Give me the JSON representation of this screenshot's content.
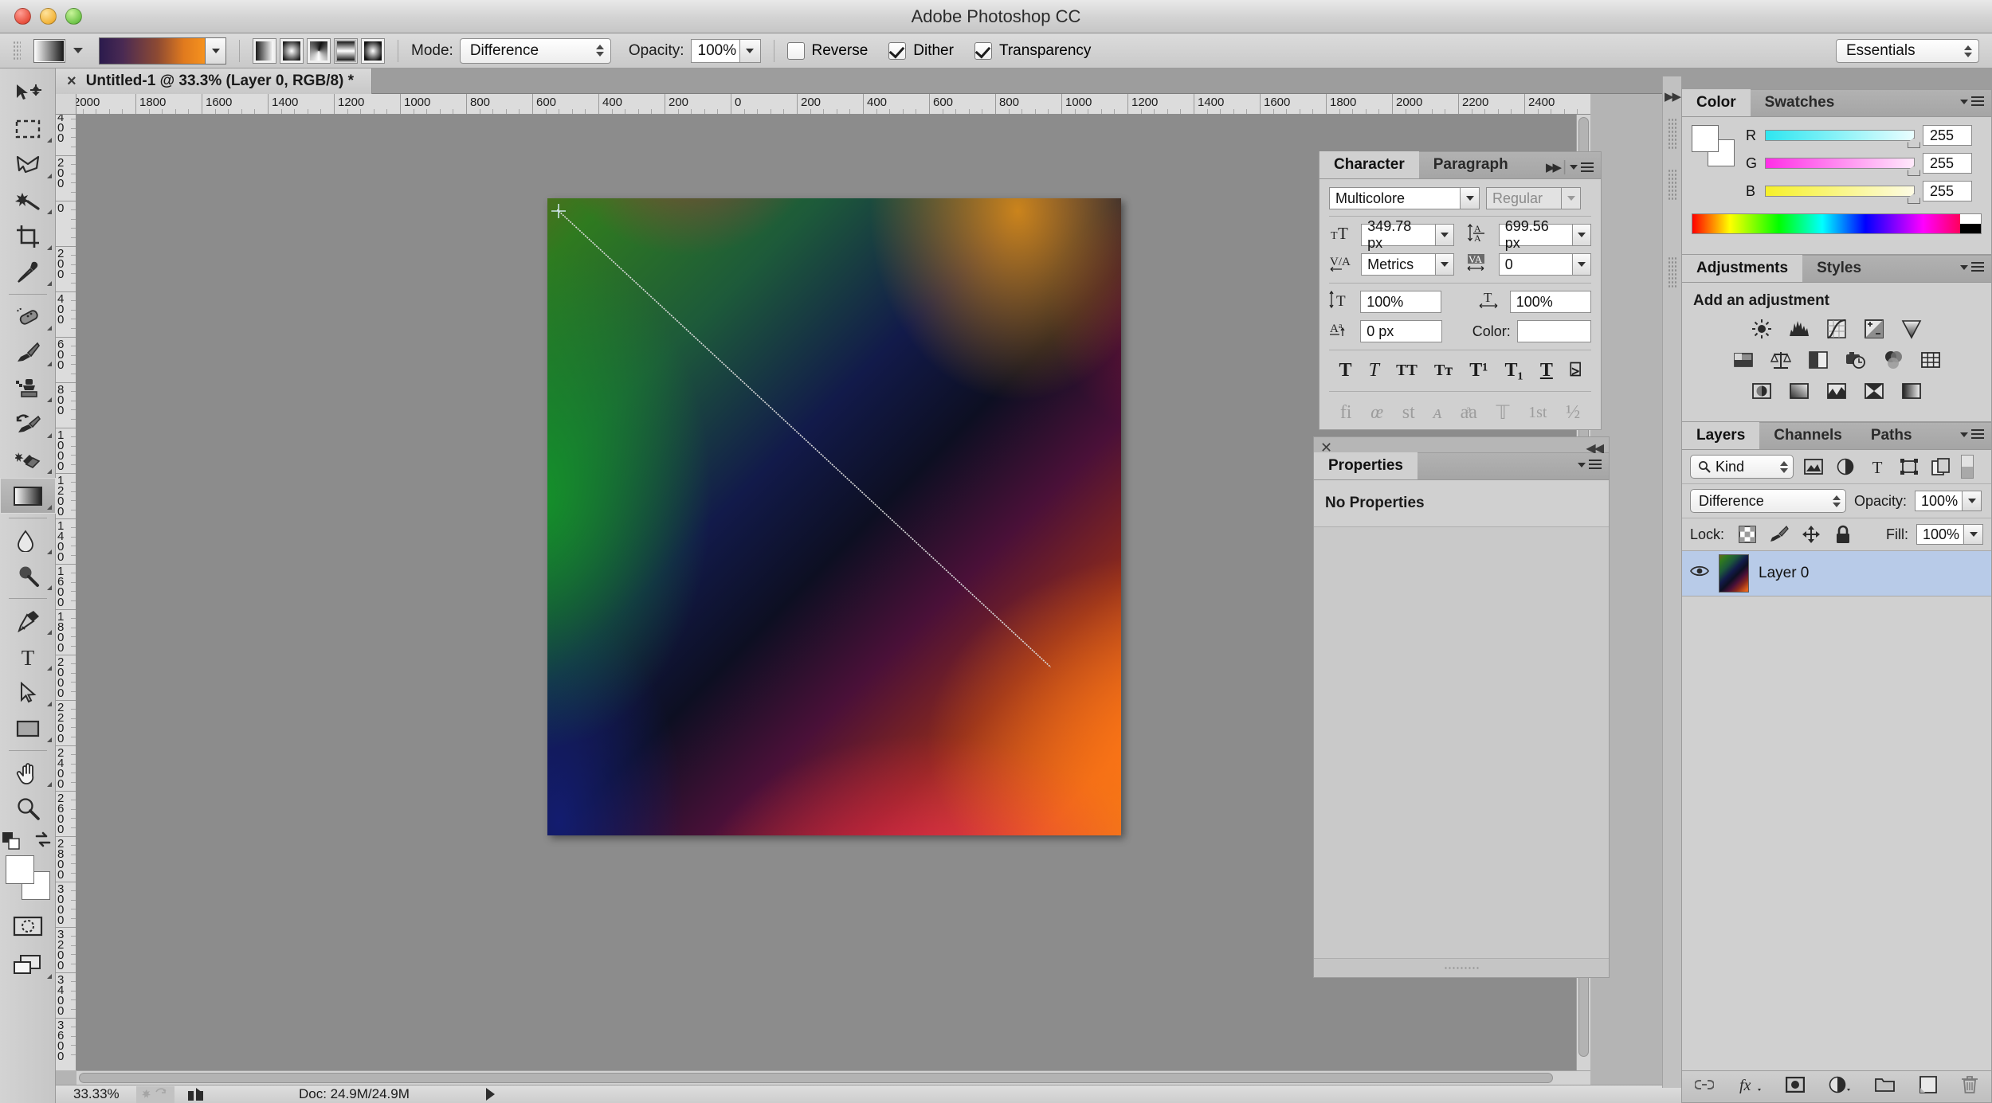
{
  "window": {
    "title": "Adobe Photoshop CC"
  },
  "options_bar": {
    "mode_label": "Mode:",
    "mode_value": "Difference",
    "opacity_label": "Opacity:",
    "opacity_value": "100%",
    "reverse_label": "Reverse",
    "reverse_checked": false,
    "dither_label": "Dither",
    "dither_checked": true,
    "transparency_label": "Transparency",
    "transparency_checked": true,
    "gradient_types": [
      "linear-gradient-icon",
      "radial-gradient-icon",
      "angle-gradient-icon",
      "reflected-gradient-icon",
      "diamond-gradient-icon"
    ],
    "selected_gradient_type": "reflected-gradient-icon",
    "workspace": "Essentials"
  },
  "document_tab": {
    "close": "×",
    "label": "Untitled‑1 @ 33.3% (Layer 0, RGB/8) *"
  },
  "rulers": {
    "horizontal": [
      "2000",
      "1800",
      "1600",
      "1400",
      "1200",
      "1000",
      "800",
      "600",
      "400",
      "200",
      "0",
      "200",
      "400",
      "600",
      "800",
      "1000",
      "1200",
      "1400",
      "1600",
      "1800",
      "2000",
      "2200",
      "2400"
    ],
    "vertical": [
      "400",
      "200",
      "0",
      "200",
      "400",
      "600",
      "800",
      "1000",
      "1200",
      "1400",
      "1600",
      "1800",
      "2000",
      "2200",
      "2400",
      "2600",
      "2800",
      "3000",
      "3200",
      "3400",
      "3600"
    ]
  },
  "toolbar": {
    "tools": [
      {
        "name": "move-tool",
        "glyph": "move"
      },
      {
        "name": "rectangular-marquee-tool",
        "glyph": "marquee"
      },
      {
        "name": "lasso-tool",
        "glyph": "lasso"
      },
      {
        "name": "magic-wand-tool",
        "glyph": "wand"
      },
      {
        "name": "crop-tool",
        "glyph": "crop"
      },
      {
        "name": "eyedropper-tool",
        "glyph": "eyedropper"
      },
      {
        "name": "spot-healing-brush-tool",
        "glyph": "healing"
      },
      {
        "name": "brush-tool",
        "glyph": "brush"
      },
      {
        "name": "clone-stamp-tool",
        "glyph": "stamp"
      },
      {
        "name": "history-brush-tool",
        "glyph": "historybrush"
      },
      {
        "name": "eraser-tool",
        "glyph": "eraser"
      },
      {
        "name": "gradient-tool",
        "glyph": "gradient",
        "selected": true
      },
      {
        "name": "blur-tool",
        "glyph": "blur"
      },
      {
        "name": "dodge-tool",
        "glyph": "dodge"
      },
      {
        "name": "pen-tool",
        "glyph": "pen"
      },
      {
        "name": "horizontal-type-tool",
        "glyph": "type"
      },
      {
        "name": "path-selection-tool",
        "glyph": "pathselect"
      },
      {
        "name": "rectangle-tool",
        "glyph": "rectangle"
      },
      {
        "name": "hand-tool",
        "glyph": "hand"
      },
      {
        "name": "zoom-tool",
        "glyph": "zoom"
      }
    ],
    "foreground_color": "#ffffff",
    "background_color": "#ffffff",
    "quick_mask": "quick-mask-icon",
    "screen_mode": "screen-mode-icon"
  },
  "character_panel": {
    "tabs": [
      "Character",
      "Paragraph"
    ],
    "active_tab": "Character",
    "font_family": "Multicolore",
    "font_style": "Regular",
    "font_size": "349.78 px",
    "leading": "699.56 px",
    "kerning": "Metrics",
    "tracking": "0",
    "vertical_scale": "100%",
    "horizontal_scale": "100%",
    "baseline_shift": "0 px",
    "color_label": "Color:",
    "color_value": "#ffffff",
    "style_buttons": [
      "T",
      "T",
      "TT",
      "Tᴛ",
      "T¹",
      "T₁",
      "T",
      "⍄"
    ],
    "ot_buttons": [
      "fi",
      "œ",
      "st",
      "ᴀ",
      "aͣa",
      "𝕋",
      "1st",
      "½"
    ]
  },
  "properties_panel": {
    "tab": "Properties",
    "content": "No Properties",
    "close": "✕"
  },
  "color_panel": {
    "tabs": [
      "Color",
      "Swatches"
    ],
    "active_tab": "Color",
    "channels": [
      {
        "label": "R",
        "value": "255",
        "from": "#2ee6f0",
        "to": "#e8feff"
      },
      {
        "label": "G",
        "value": "255",
        "from": "#ff2ee6",
        "to": "#ffe9fb"
      },
      {
        "label": "B",
        "value": "255",
        "from": "#f5f028",
        "to": "#fdfbe0"
      }
    ]
  },
  "adjustments_panel": {
    "tabs": [
      "Adjustments",
      "Styles"
    ],
    "active_tab": "Adjustments",
    "heading": "Add an adjustment",
    "icons_row1": [
      "brightness-contrast-icon",
      "levels-icon",
      "curves-icon",
      "exposure-icon",
      "vibrance-icon"
    ],
    "icons_row2": [
      "hue-saturation-icon",
      "color-balance-icon",
      "black-white-icon",
      "photo-filter-icon",
      "channel-mixer-icon",
      "color-lookup-icon"
    ],
    "icons_row3": [
      "invert-icon",
      "posterize-icon",
      "threshold-icon",
      "selective-color-icon",
      "gradient-map-icon"
    ]
  },
  "layers_panel": {
    "tabs": [
      "Layers",
      "Channels",
      "Paths"
    ],
    "active_tab": "Layers",
    "filter_kind": "Kind",
    "filter_icons": [
      "pixel-filter-icon",
      "adjustment-filter-icon",
      "type-filter-icon",
      "shape-filter-icon",
      "smartobject-filter-icon"
    ],
    "blend_mode": "Difference",
    "opacity_label": "Opacity:",
    "opacity_value": "100%",
    "lock_label": "Lock:",
    "lock_icons": [
      "lock-transparent-pixels-icon",
      "lock-image-pixels-icon",
      "lock-position-icon",
      "lock-all-icon"
    ],
    "fill_label": "Fill:",
    "fill_value": "100%",
    "layers": [
      {
        "name": "Layer 0",
        "visible": true,
        "selected": true
      }
    ],
    "footer_icons": [
      "link-layers-icon",
      "layer-style-icon",
      "layer-mask-icon",
      "new-fill-adjustment-icon",
      "new-group-icon",
      "new-layer-icon",
      "delete-layer-icon"
    ],
    "footer_labels": [
      "🔗",
      "fx",
      "▣",
      "◑",
      "▢",
      "⬚",
      "🗑"
    ]
  },
  "status_bar": {
    "zoom": "33.33%",
    "doc": "Doc: 24.9M/24.9M"
  },
  "canvas": {
    "zoom_level": "33.33%",
    "gradient_line_color": "#d8d8d8"
  }
}
